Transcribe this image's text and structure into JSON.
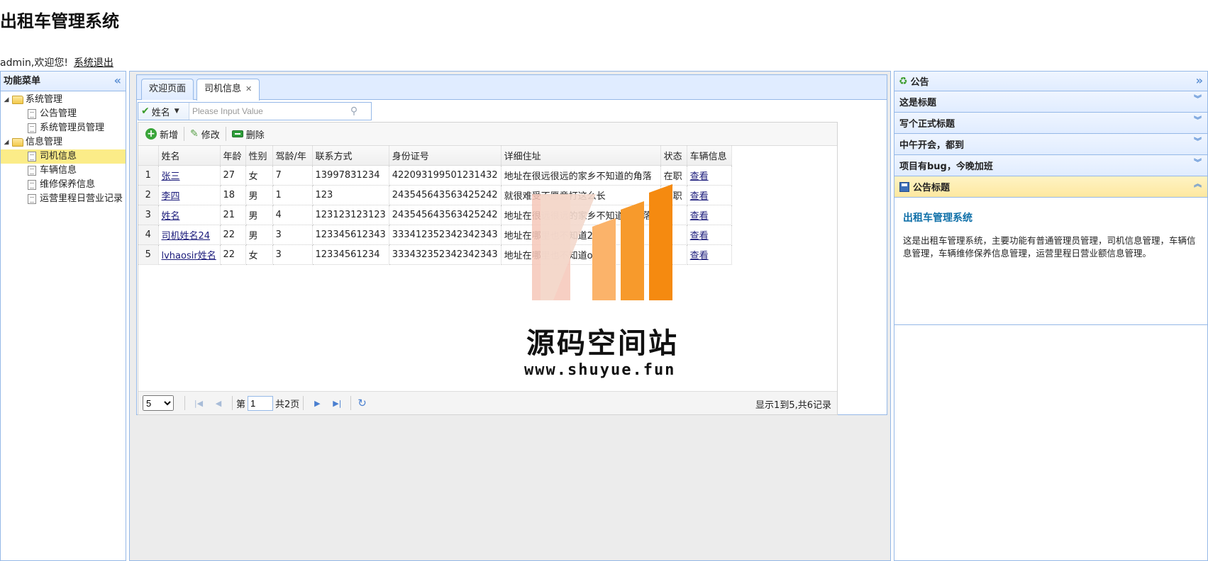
{
  "header": {
    "app_title": "出租车管理系统",
    "welcome_text": "admin,欢迎您!",
    "logout_link": "系统退出"
  },
  "west": {
    "title": "功能菜单",
    "groups": [
      {
        "label": "系统管理",
        "items": [
          "公告管理",
          "系统管理员管理"
        ]
      },
      {
        "label": "信息管理",
        "items": [
          "司机信息",
          "车辆信息",
          "维修保养信息",
          "运营里程日营业记录"
        ],
        "selected": "司机信息"
      }
    ]
  },
  "center": {
    "tabs": [
      {
        "label": "欢迎页面",
        "active": false
      },
      {
        "label": "司机信息",
        "active": true,
        "closable": true
      }
    ],
    "search": {
      "field": "姓名",
      "placeholder": "Please Input Value"
    },
    "toolbar": {
      "add": "新增",
      "edit": "修改",
      "delete": "删除"
    },
    "columns": [
      "姓名",
      "年龄",
      "性别",
      "驾龄/年",
      "联系方式",
      "身份证号",
      "详细住址",
      "状态",
      "车辆信息"
    ],
    "rows": [
      {
        "no": "1",
        "name": "张三",
        "age": "27",
        "gender": "女",
        "years": "7",
        "phone": "13997831234",
        "idcard": "422093199501231432",
        "address": "地址在很远很远的家乡不知道的角落",
        "status": "在职",
        "car": "查看"
      },
      {
        "no": "2",
        "name": "李四",
        "age": "18",
        "gender": "男",
        "years": "1",
        "phone": "123",
        "idcard": "243545643563425242",
        "address": "就很难受不愿意打这么长",
        "status": "在职",
        "car": "查看"
      },
      {
        "no": "3",
        "name": "姓名",
        "age": "21",
        "gender": "男",
        "years": "4",
        "phone": "123123123123",
        "idcard": "243545643563425242",
        "address": "地址在很远很远的家乡不知道的角落",
        "status": "",
        "car": "查看"
      },
      {
        "no": "4",
        "name": "司机姓名24",
        "age": "22",
        "gender": "男",
        "years": "3",
        "phone": "123345612343",
        "idcard": "333412352342342343",
        "address": "地址在哪里也不知道2",
        "status": "",
        "car": "查看"
      },
      {
        "no": "5",
        "name": "lvhaosir姓名",
        "age": "22",
        "gender": "女",
        "years": "3",
        "phone": "12334561234",
        "idcard": "333432352342342343",
        "address": "地址在哪里也不知道ob",
        "status": "",
        "car": "查看"
      }
    ],
    "pager": {
      "page_size": "5",
      "page_label_prefix": "第",
      "current_page": "1",
      "total_pages": "共2页",
      "info": "显示1到5,共6记录"
    }
  },
  "east": {
    "title": "公告",
    "items": [
      {
        "label": "这是标题"
      },
      {
        "label": "写个正式标题"
      },
      {
        "label": "中午开会，都到"
      },
      {
        "label": "项目有bug，今晚加班"
      },
      {
        "label": "公告标题",
        "open": true
      }
    ],
    "open_item": {
      "heading": "出租车管理系统",
      "content": "这是出租车管理系统，主要功能有普通管理员管理，司机信息管理，车辆信息管理，车辆维修保养信息管理，运营里程日营业额信息管理。"
    }
  },
  "watermark": {
    "name": "源码空间站",
    "url": "www.shuyue.fun",
    "colors": [
      "#f6c7b9",
      "#fbb36a",
      "#f79a2c",
      "#f58a10"
    ]
  },
  "colors": {
    "border": "#95b8e7",
    "header_bg": "#e0ecff",
    "selected_bg": "#fbec88"
  }
}
